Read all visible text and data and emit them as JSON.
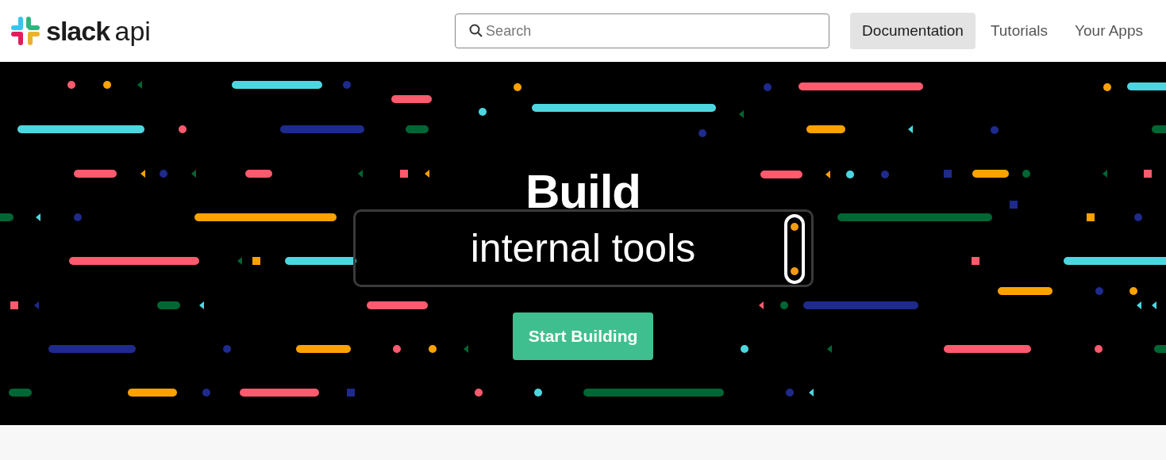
{
  "header": {
    "logo": {
      "word": "slack",
      "suffix": "api"
    },
    "search": {
      "placeholder": "Search"
    },
    "nav": [
      {
        "label": "Documentation",
        "selected": true
      },
      {
        "label": "Tutorials",
        "selected": false
      },
      {
        "label": "Your Apps",
        "selected": false
      }
    ]
  },
  "hero": {
    "title": "Build",
    "phrase": "internal tools",
    "button": "Start Building"
  }
}
